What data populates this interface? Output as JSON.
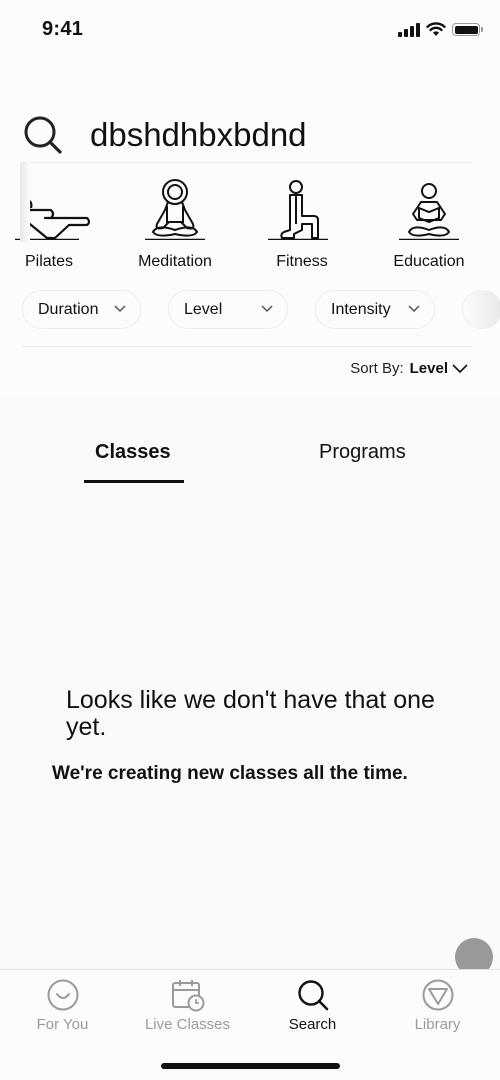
{
  "status_bar": {
    "time": "9:41",
    "icons": [
      "cellular-signal-icon",
      "wifi-icon",
      "battery-icon"
    ]
  },
  "search": {
    "icon": "search-icon",
    "value": "dbshdhbxbdnd",
    "placeholder": ""
  },
  "categories": [
    {
      "label": "Pilates",
      "icon": "pilates-icon"
    },
    {
      "label": "Meditation",
      "icon": "meditation-icon"
    },
    {
      "label": "Fitness",
      "icon": "fitness-icon"
    },
    {
      "label": "Education",
      "icon": "education-icon"
    }
  ],
  "filters": [
    {
      "label": "Duration",
      "icon": "chevron-down-icon"
    },
    {
      "label": "Level",
      "icon": "chevron-down-icon"
    },
    {
      "label": "Intensity",
      "icon": "chevron-down-icon"
    }
  ],
  "sort": {
    "label": "Sort By:",
    "value": "Level",
    "icon": "chevron-down-icon"
  },
  "tabs": [
    {
      "label": "Classes",
      "active": true
    },
    {
      "label": "Programs",
      "active": false
    }
  ],
  "empty_state": {
    "title": "Looks like we don't have that one yet.",
    "subtitle": "We're creating new classes all the time."
  },
  "tabbar": [
    {
      "label": "For You",
      "icon": "smile-icon",
      "active": false
    },
    {
      "label": "Live Classes",
      "icon": "calendar-clock-icon",
      "active": false
    },
    {
      "label": "Search",
      "icon": "search-icon",
      "active": true
    },
    {
      "label": "Library",
      "icon": "library-triangle-icon",
      "active": false
    }
  ],
  "colors": {
    "text": "#111111",
    "inactive": "#9b9a9b",
    "background": "#fdfcfd",
    "content_background": "#fbf9fa",
    "fab": "#999999"
  }
}
